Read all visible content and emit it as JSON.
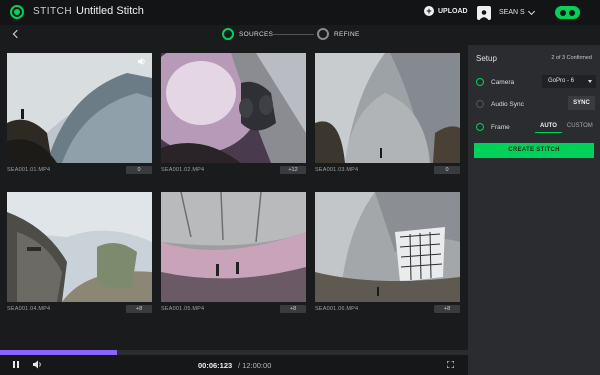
{
  "header": {
    "brand": "STITCH",
    "title": "Untitled Stitch",
    "upload_label": "UPLOAD",
    "user_name": "SEAN S"
  },
  "steps": [
    {
      "label": "SOURCES",
      "active": true
    },
    {
      "label": "REFINE",
      "active": false
    }
  ],
  "clips": [
    {
      "name": "SEA001.01.MP4",
      "offset": "0",
      "muted": false
    },
    {
      "name": "SEA001.02.MP4",
      "offset": "+12"
    },
    {
      "name": "SEA001.03.MP4",
      "offset": "0"
    },
    {
      "name": "SEA001.04.MP4",
      "offset": "+8"
    },
    {
      "name": "SEA001.05.MP4",
      "offset": "+8"
    },
    {
      "name": "SEA001.06.MP4",
      "offset": "+8"
    }
  ],
  "setup": {
    "heading": "Setup",
    "confirmed": "2 of 3 Confirmed",
    "camera_label": "Camera",
    "camera_value": "GoPro - 6",
    "audio_sync_label": "Audio Sync",
    "sync_button": "SYNC",
    "frame_label": "Frame",
    "frame_options": [
      "AUTO",
      "CUSTOM"
    ],
    "frame_selected": "AUTO",
    "create_button": "CREATE STITCH"
  },
  "playback": {
    "current_time": "00:06:123",
    "duration": "/ 12:00:00",
    "progress": 0.25
  },
  "colors": {
    "accent": "#00d15b",
    "progress": "#8a63ff",
    "panel": "#2b2c2f",
    "background": "#1a1b1d"
  }
}
